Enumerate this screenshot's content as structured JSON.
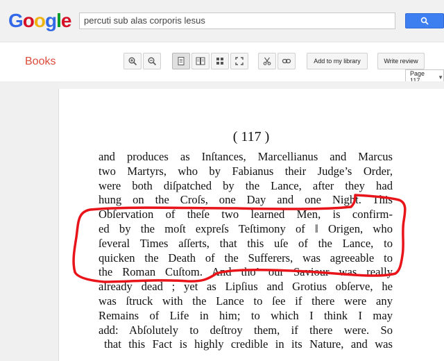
{
  "header": {
    "logo": [
      "G",
      "o",
      "o",
      "g",
      "l",
      "e"
    ],
    "logo_colors": [
      "#3369e8",
      "#d50f25",
      "#eeb211",
      "#3369e8",
      "#009925",
      "#d50f25"
    ],
    "search_value": "percuti sub alas corporis lesus",
    "search_icon": "magnifier-icon"
  },
  "toolbar": {
    "books_label": "Books",
    "add_library_label": "Add to my library",
    "write_review_label": "Write review",
    "page_select": "Page 117",
    "icons": [
      "zoom-in-icon",
      "zoom-out-icon",
      "single-page-icon",
      "two-page-icon",
      "thumbnail-icon",
      "fullscreen-icon",
      "clip-icon",
      "link-icon"
    ]
  },
  "book_page": {
    "page_number": "( 117 )",
    "lines": [
      "and produces as Inſtances, Marcellianus and Marcus",
      "two Martyrs, who by Fabianus their Judge’s Order,",
      "were both diſpatched by the Lance, after they had",
      "hung on the Croſs, one Day and one Night. This",
      "Obſervation of theſe two learned Men, is confirm-",
      "ed by the moſt expreſs Teſtimony of ‖ Origen, who",
      "ſeveral Times aſſerts, that this uſe of the Lance, to",
      "quicken the Death of the Sufferers, was agreeable to",
      "the Roman Cuſtom. And tho’ our Saviour was really",
      "already dead ; yet as Lipſius and Grotius obſerve, he",
      "was ſtruck with the Lance to ſee if there were any",
      "Remains of Life in him; to which I think I may",
      "add: Abſolutely to deſtroy them, if there were. So",
      "that this Fact is highly credible in its Nature, and was"
    ]
  },
  "annotation": {
    "color": "#e8141a",
    "shape": "freehand-outline"
  }
}
